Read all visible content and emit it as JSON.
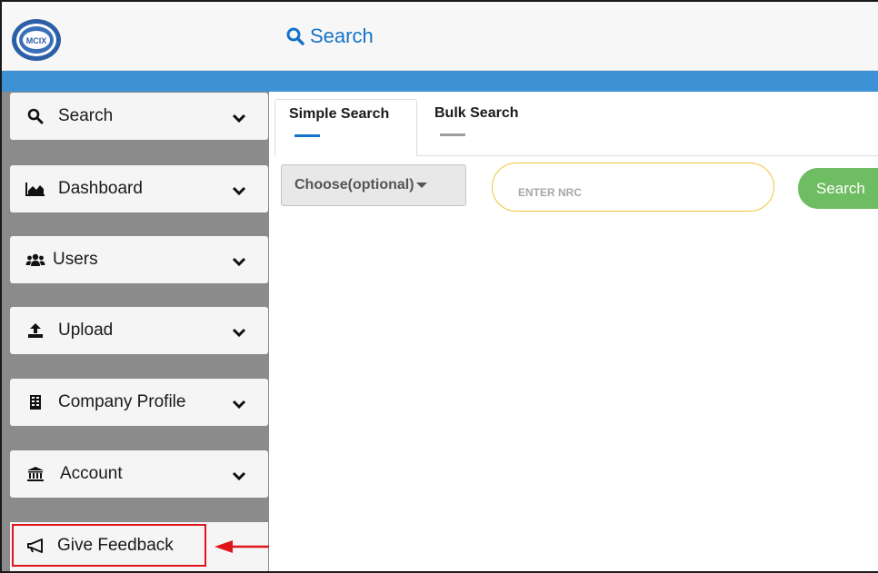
{
  "header": {
    "logo_text": "MCIX",
    "title": "Search"
  },
  "sidebar": {
    "items": [
      {
        "label": "Search",
        "icon": "search-icon"
      },
      {
        "label": "Dashboard",
        "icon": "area-chart-icon"
      },
      {
        "label": "Users",
        "icon": "users-icon"
      },
      {
        "label": "Upload",
        "icon": "upload-icon"
      },
      {
        "label": "Company Profile",
        "icon": "building-icon"
      },
      {
        "label": "Account",
        "icon": "bank-icon"
      }
    ],
    "feedback": {
      "label": "Give Feedback",
      "icon": "megaphone-icon"
    }
  },
  "tabs": [
    {
      "label": "Simple Search",
      "active": true,
      "indicator_color": "#1473c9"
    },
    {
      "label": "Bulk Search",
      "active": false,
      "indicator_color": "#9e9e9e"
    }
  ],
  "search_form": {
    "choose_label": "Choose(optional)",
    "nrc_placeholder": "ENTER NRC",
    "search_button": "Search"
  },
  "colors": {
    "accent_blue": "#1473c9",
    "header_bar": "#3d92d6",
    "sidebar_bg": "#8b8b8b",
    "highlight_red": "#e0151a",
    "search_button": "#6fbd62",
    "input_border": "#f0c43a"
  }
}
